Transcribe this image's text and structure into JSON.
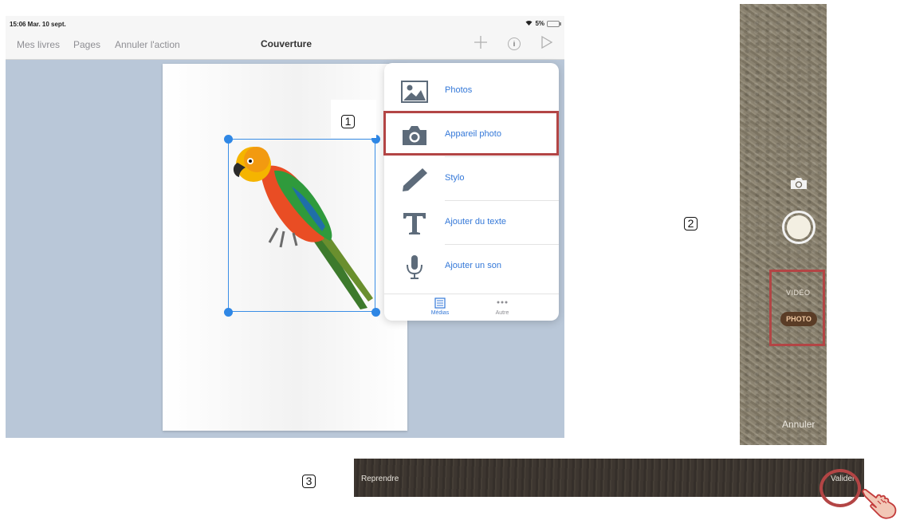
{
  "status_bar": {
    "time": "15:06  Mar. 10 sept.",
    "battery": "5%"
  },
  "nav": {
    "my_books": "Mes livres",
    "pages": "Pages",
    "undo": "Annuler l'action",
    "title": "Couverture",
    "add_icon": "plus-icon",
    "info_icon": "info-icon",
    "play_icon": "play-icon"
  },
  "media_menu": {
    "items": [
      {
        "label": "Photos",
        "icon": "photos-icon"
      },
      {
        "label": "Appareil photo",
        "icon": "camera-icon"
      },
      {
        "label": "Stylo",
        "icon": "pen-icon"
      },
      {
        "label": "Ajouter du texte",
        "icon": "text-icon"
      },
      {
        "label": "Ajouter un son",
        "icon": "microphone-icon"
      }
    ],
    "tabs": [
      {
        "label": "Médias",
        "icon": "list-icon"
      },
      {
        "label": "Autre",
        "icon": "more-icon"
      }
    ]
  },
  "camera": {
    "mode_video": "VIDÉO",
    "mode_photo": "PHOTO",
    "cancel": "Annuler"
  },
  "review_bar": {
    "retake": "Reprendre",
    "validate": "Valider"
  },
  "steps": [
    "1",
    "2",
    "3"
  ],
  "colors": {
    "accent": "#3478d8",
    "selection": "#2f87e5",
    "highlight": "#b34545",
    "canvas": "#b9c7d8"
  }
}
